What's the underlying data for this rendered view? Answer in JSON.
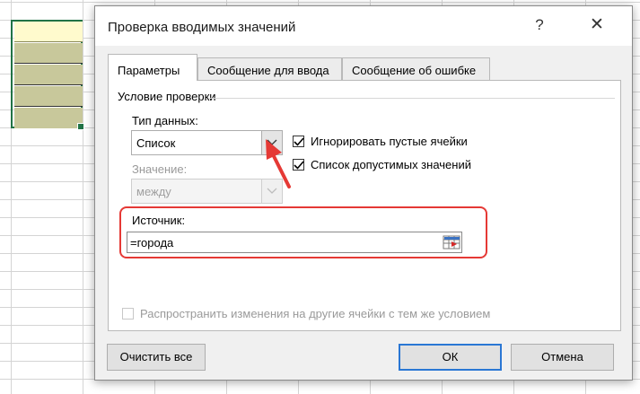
{
  "dialog": {
    "title": "Проверка вводимых значений",
    "help_glyph": "?",
    "close_glyph": "✕"
  },
  "tabs": [
    {
      "label": "Параметры",
      "active": true
    },
    {
      "label": "Сообщение для ввода",
      "active": false
    },
    {
      "label": "Сообщение об ошибке",
      "active": false
    }
  ],
  "params": {
    "section_label": "Условие проверки",
    "data_type_label": "Тип данных:",
    "data_type_value": "Список",
    "value_label": "Значение:",
    "value_value": "между",
    "ignore_blank_label": "Игнорировать пустые ячейки",
    "ignore_blank_checked": true,
    "in_cell_dropdown_label": "Список допустимых значений",
    "in_cell_dropdown_checked": true,
    "source_label": "Источник:",
    "source_value": "=города",
    "apply_all_label": "Распространить изменения на другие ячейки с тем же условием",
    "apply_all_checked": false
  },
  "buttons": {
    "clear_all": "Очистить все",
    "ok": "ОК",
    "cancel": "Отмена"
  },
  "colors": {
    "annotation": "#e53935",
    "selection_border": "#217346",
    "ok_focus": "#2a77d4"
  },
  "icons": {
    "dropdown": "chevron-down-icon",
    "range_picker": "range-select-icon",
    "check": "checkmark-icon"
  }
}
